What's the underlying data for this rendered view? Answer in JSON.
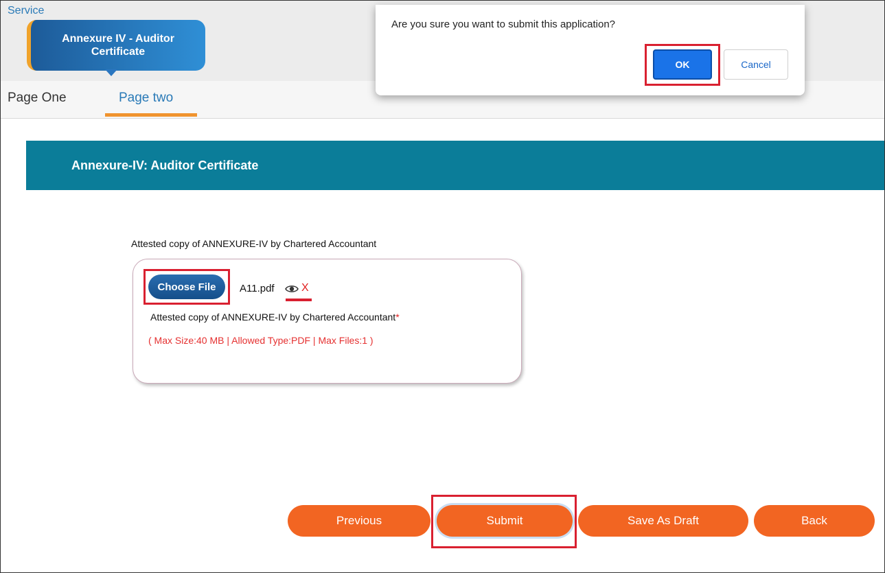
{
  "header": {
    "service_link": "Service",
    "service_title": "Annexure IV - Auditor Certificate"
  },
  "tabs": [
    {
      "label": "Page One",
      "active": false
    },
    {
      "label": "Page two",
      "active": true
    }
  ],
  "section": {
    "title": "Annexure-IV: Auditor Certificate"
  },
  "upload": {
    "field_label": "Attested copy of ANNEXURE-IV by Chartered Accountant",
    "choose_file_label": "Choose File",
    "file_name": "A11.pdf",
    "view_icon": "eye-icon",
    "remove_label": "X",
    "card_label": "Attested copy of ANNEXURE-IV by Chartered Accountant",
    "required_marker": "*",
    "constraints_note": "( Max Size:40 MB | Allowed Type:PDF | Max Files:1 )"
  },
  "actions": {
    "previous_label": "Previous",
    "submit_label": "Submit",
    "save_draft_label": "Save As Draft",
    "back_label": "Back"
  },
  "dialog": {
    "message": "Are you sure you want to submit this application?",
    "ok_label": "OK",
    "cancel_label": "Cancel"
  },
  "colors": {
    "section_header": "#0b7d99",
    "action_button": "#f26522",
    "link": "#2a7ab7",
    "highlight": "#d92030",
    "dialog_primary": "#1a73e8"
  }
}
